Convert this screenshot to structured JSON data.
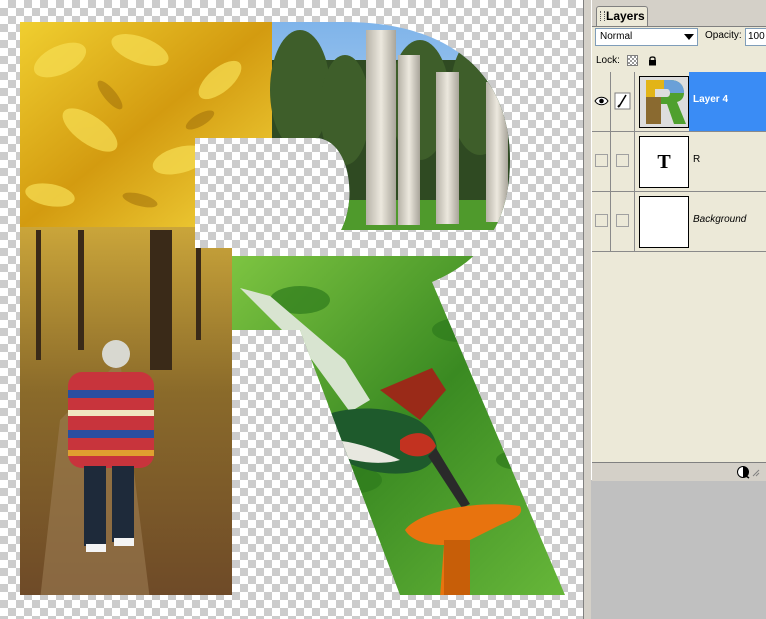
{
  "layers_panel": {
    "tab_label": "Layers",
    "blend_mode": "Normal",
    "opacity_label": "Opacity:",
    "opacity_value": "100",
    "lock_label": "Lock:",
    "layers": [
      {
        "name": "Layer 4",
        "selected": true,
        "visible": true,
        "thumb": "photo-collage-r"
      },
      {
        "name": "R",
        "selected": false,
        "visible": false,
        "thumb": "text-layer-t"
      },
      {
        "name": "Background",
        "selected": false,
        "visible": false,
        "thumb": "white"
      }
    ],
    "text_layer_glyph": "T"
  },
  "icons": {
    "eye": "eye-icon",
    "brush": "brush-link-icon",
    "lock_transparent": "lock-transparency-icon",
    "lock_all": "lock-all-icon",
    "new_layer": "new-layer-icon"
  },
  "colors": {
    "selection": "#3a8cf5",
    "panel_bg": "#ece9d8",
    "foliage_yellow": "#e2b418",
    "grass_green": "#3f8c22",
    "forest_brown": "#7a5a32",
    "sky_blue": "#8ec0ee",
    "column_stone": "#d9d5cb",
    "hummingbird_green": "#1f5a2c",
    "flower_orange": "#e8730e"
  }
}
